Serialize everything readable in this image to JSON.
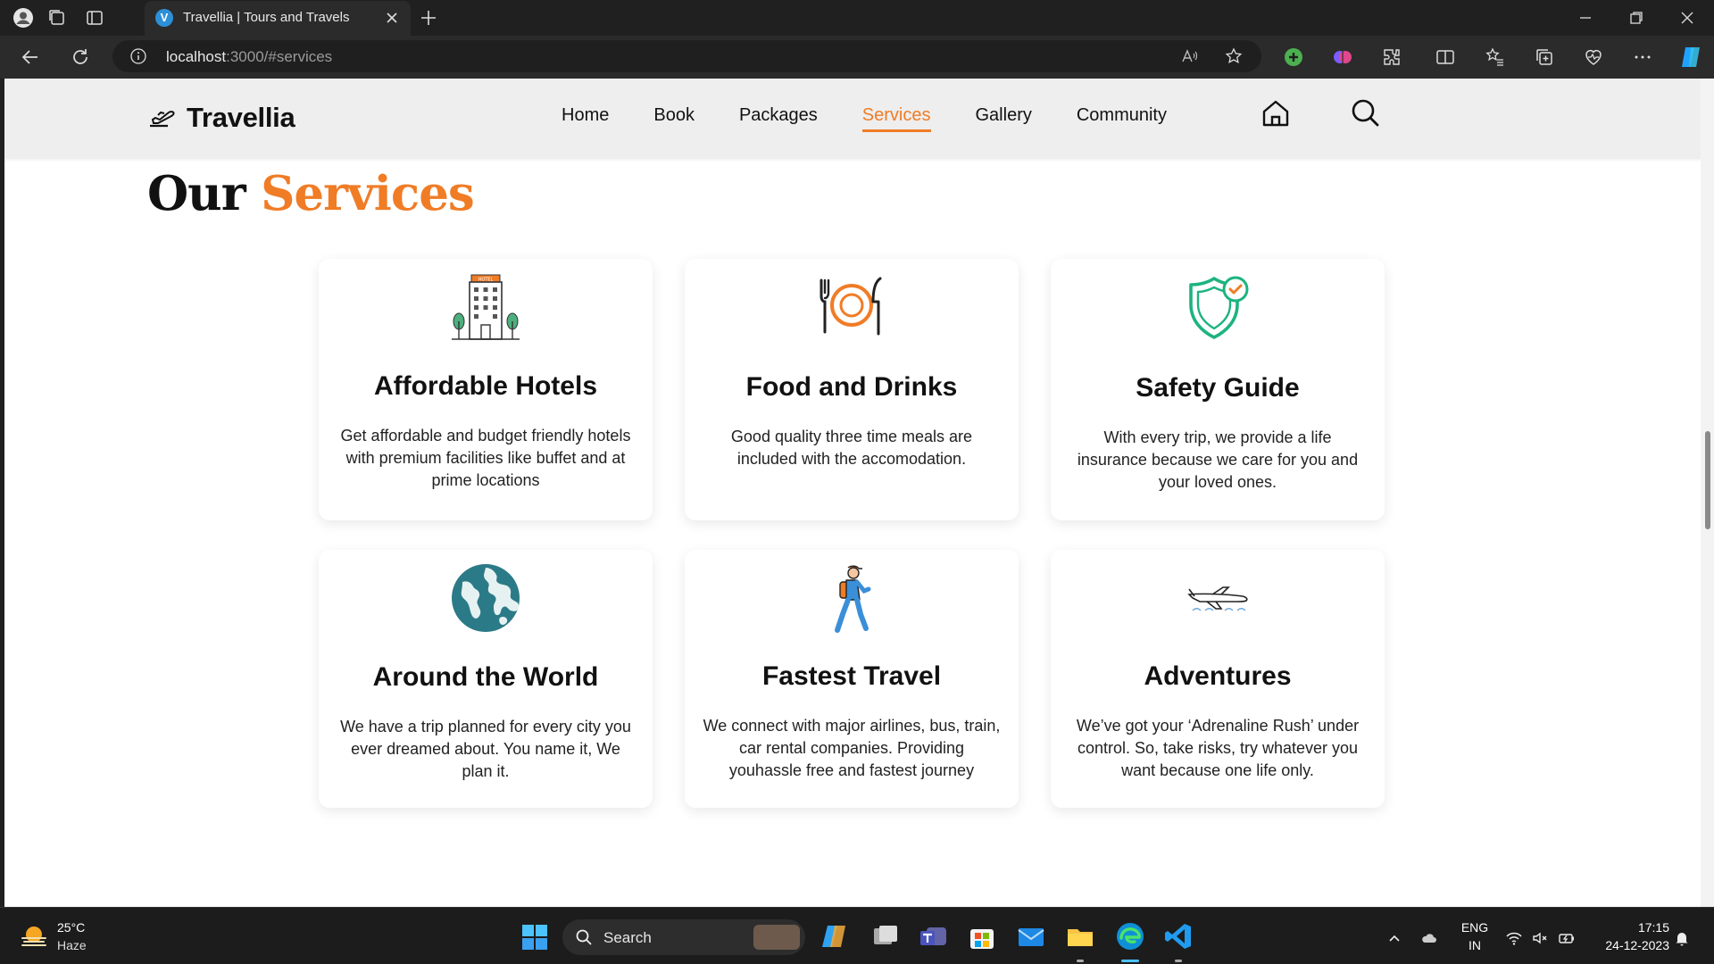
{
  "browser": {
    "tab_title": "Travellia | Tours and Travels",
    "tab_favicon_letter": "V",
    "url_host": "localhost",
    "url_rest": ":3000/#services"
  },
  "site": {
    "brand": "Travellia",
    "nav": [
      "Home",
      "Book",
      "Packages",
      "Services",
      "Gallery",
      "Community"
    ],
    "active_nav": "Services",
    "accent_color": "#f07c26"
  },
  "services": {
    "title_plain": "Our",
    "title_accent": "Services",
    "cards": [
      {
        "icon": "hotel-building-icon",
        "title": "Affordable Hotels",
        "text": "Get affordable and budget friendly hotels with premium facilities like buffet and at prime locations"
      },
      {
        "icon": "fork-plate-knife-icon",
        "title": "Food and Drinks",
        "text": "Good quality three time meals are included with the accomodation."
      },
      {
        "icon": "shield-check-icon",
        "title": "Safety Guide",
        "text": "With every trip, we provide a life insurance because we care for you and your loved ones."
      },
      {
        "icon": "globe-icon",
        "title": "Around the World",
        "text": "We have a trip planned for every city you ever dreamed about. You name it, We plan it."
      },
      {
        "icon": "walking-traveler-icon",
        "title": "Fastest Travel",
        "text": "We connect with major airlines, bus, train, car rental companies. Providing youhassle free and fastest journey"
      },
      {
        "icon": "airplane-icon",
        "title": "Adventures",
        "text": "We’ve got your ‘Adrenaline Rush’ under control. So, take risks, try whatever you want because one life only."
      }
    ]
  },
  "taskbar": {
    "temperature": "25°C",
    "weather": "Haze",
    "search_placeholder": "Search",
    "language_1": "ENG",
    "language_2": "IN",
    "time": "17:15",
    "date": "24-12-2023"
  }
}
